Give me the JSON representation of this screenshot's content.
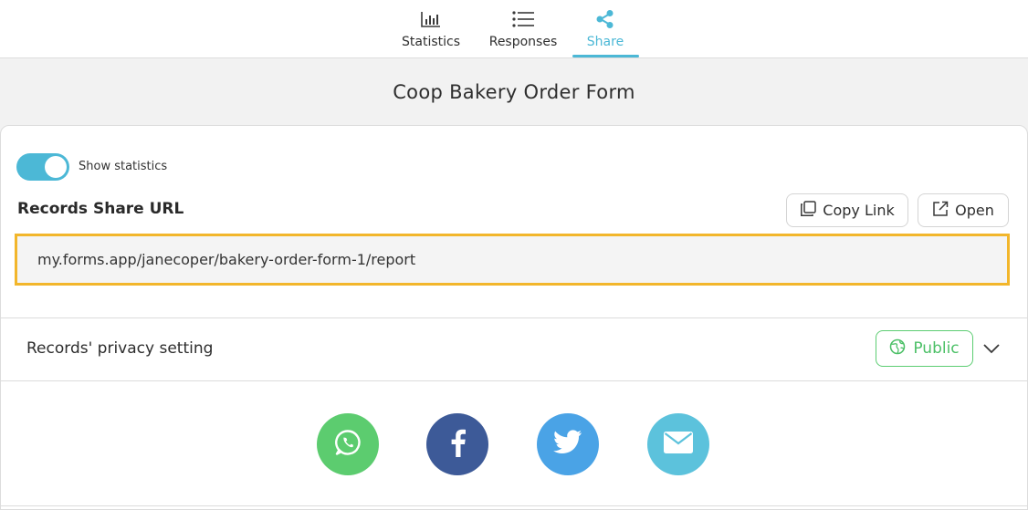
{
  "tabs": [
    {
      "label": "Statistics",
      "icon": "bar-chart-icon",
      "active": false
    },
    {
      "label": "Responses",
      "icon": "list-icon",
      "active": false
    },
    {
      "label": "Share",
      "icon": "share-icon",
      "active": true
    }
  ],
  "form_title": "Coop Bakery Order Form",
  "share": {
    "toggle_label": "Show statistics",
    "toggle_on": true,
    "url_heading": "Records Share URL",
    "copy_label": "Copy Link",
    "open_label": "Open",
    "url": "my.forms.app/janecoper/bakery-order-form-1/report"
  },
  "privacy": {
    "label": "Records' privacy setting",
    "value": "Public"
  },
  "social": [
    {
      "name": "whatsapp",
      "color": "#5ccc6f"
    },
    {
      "name": "facebook",
      "color": "#3d5a98"
    },
    {
      "name": "twitter",
      "color": "#4aa3e6"
    },
    {
      "name": "email",
      "color": "#5cc2dc"
    }
  ],
  "colors": {
    "accent": "#4cb8d6",
    "highlight_border": "#f2b62b",
    "public_green": "#4cc067"
  }
}
